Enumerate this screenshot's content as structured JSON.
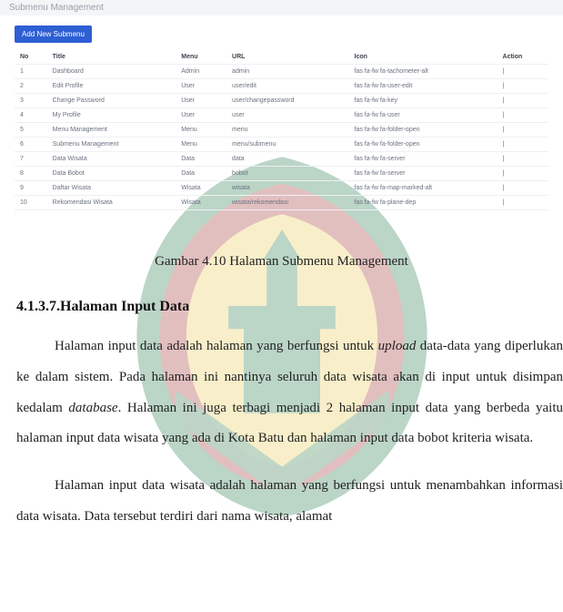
{
  "breadcrumb": {
    "label": "Submenu Management"
  },
  "toolbar": {
    "add_new_label": "Add New Submenu"
  },
  "table": {
    "headers": {
      "no": "No",
      "title": "Title",
      "menu": "Menu",
      "url": "URL",
      "icon": "Icon",
      "action": "Action"
    },
    "rows": [
      {
        "no": "1",
        "title": "Dashboard",
        "menu": "Admin",
        "url": "admin",
        "icon": "fas fa-fw fa-tachometer-alt",
        "action": "|"
      },
      {
        "no": "2",
        "title": "Edit Profile",
        "menu": "User",
        "url": "user/edit",
        "icon": "fas fa-fw fa-user-edit",
        "action": "|"
      },
      {
        "no": "3",
        "title": "Change Password",
        "menu": "User",
        "url": "user/changepassword",
        "icon": "fas fa-fw fa-key",
        "action": "|"
      },
      {
        "no": "4",
        "title": "My Profile",
        "menu": "User",
        "url": "user",
        "icon": "fas fa-fw fa-user",
        "action": "|"
      },
      {
        "no": "5",
        "title": "Menu Management",
        "menu": "Menu",
        "url": "menu",
        "icon": "fas fa-fw fa-folder-open",
        "action": "|"
      },
      {
        "no": "6",
        "title": "Submenu Management",
        "menu": "Menu",
        "url": "menu/submenu",
        "icon": "fas fa-fw fa-folder-open",
        "action": "|"
      },
      {
        "no": "7",
        "title": "Data Wisata",
        "menu": "Data",
        "url": "data",
        "icon": "fas fa-fw fa-server",
        "action": "|"
      },
      {
        "no": "8",
        "title": "Data Bobot",
        "menu": "Data",
        "url": "bobot",
        "icon": "fas fa-fw fa-server",
        "action": "|"
      },
      {
        "no": "9",
        "title": "Daftar Wisata",
        "menu": "Wisata",
        "url": "wisata",
        "icon": "fas fa-fw fa-map-marked-alt",
        "action": "|"
      },
      {
        "no": "10",
        "title": "Rekomendasi Wisata",
        "menu": "Wisata",
        "url": "wisata/rekomendasi",
        "icon": "fas fa-fw fa-plane-dep",
        "action": "|"
      }
    ]
  },
  "caption": "Gambar 4.10 Halaman Submenu Management",
  "section": {
    "number": "4.1.3.7.",
    "title": "Halaman Input Data"
  },
  "paragraph1": {
    "t1": "Halaman input data adalah halaman yang berfungsi untuk ",
    "em1": "upload",
    "t2": " data-data yang diperlukan ke dalam sistem. Pada halaman ini nantinya seluruh data wisata akan di input untuk disimpan kedalam ",
    "em2": "database",
    "t3": ". Halaman ini juga terbagi menjadi 2 halaman input data yang berbeda yaitu halaman input data wisata yang ada di Kota Batu dan halaman input data bobot kriteria wisata."
  },
  "paragraph2": {
    "t1": "Halaman input data wisata adalah halaman yang berfungsi untuk menambahkan informasi data wisata. Data tersebut terdiri dari nama wisata, alamat"
  }
}
